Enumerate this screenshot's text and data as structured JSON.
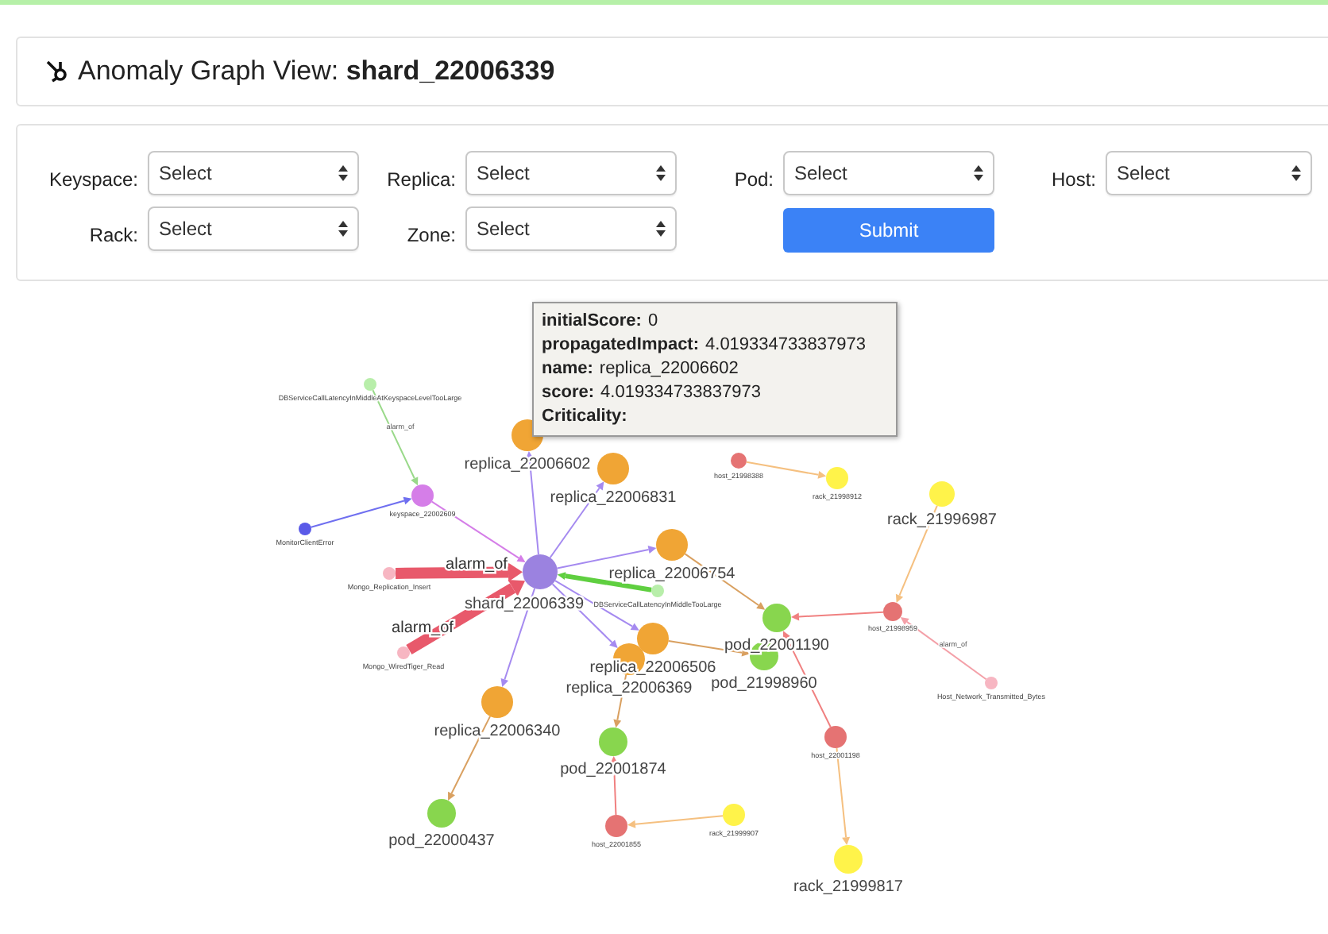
{
  "header": {
    "title": "Anomaly Graph View: **shard_22006339**"
  },
  "filters": [
    {
      "label": "Keyspace:",
      "value": "Select"
    },
    {
      "label": "Replica:",
      "value": "Select"
    },
    {
      "label": "Pod:",
      "value": "Select"
    },
    {
      "label": "Host:",
      "value": "Select"
    },
    {
      "label": "Rack:",
      "value": "Select"
    },
    {
      "label": "Zone:",
      "value": "Select"
    }
  ],
  "submit": "Submit",
  "graph": {
    "nodes": [
      {
        "label": "DBServiceCallLatencyInMiddleAtKeyspaceLevelTooLarge",
        "color": "#b8eeaa",
        "kind": "small"
      },
      {
        "label": "replica_22006602",
        "color": "#f0a535",
        "kind": "large"
      },
      {
        "label": "host_21998388",
        "color": "#e57373",
        "kind": "small"
      },
      {
        "label": "replica_22006831",
        "color": "#f0a535",
        "kind": "large"
      },
      {
        "label": "rack_21998912",
        "color": "#fff34a",
        "kind": "small"
      },
      {
        "label": "keyspace_22002609",
        "color": "#d57ee8",
        "kind": "small"
      },
      {
        "label": "rack_21996987",
        "color": "#fff34a",
        "kind": "large"
      },
      {
        "label": "MonitorClientError",
        "color": "#5a5ae8",
        "kind": "small"
      },
      {
        "label": "replica_22006754",
        "color": "#f0a535",
        "kind": "large"
      },
      {
        "label": "shard_22006339",
        "color": "#9b82e0",
        "kind": "large"
      },
      {
        "label": "Mongo_Replication_Insert",
        "color": "#f7b6c2",
        "kind": "small"
      },
      {
        "label": "DBServiceCallLatencyInMiddleTooLarge",
        "color": "#b8eeaa",
        "kind": "small"
      },
      {
        "label": "host_21998959",
        "color": "#e57373",
        "kind": "small"
      },
      {
        "label": "pod_22001190",
        "color": "#88d64e",
        "kind": "large"
      },
      {
        "label": "Mongo_WiredTiger_Read",
        "color": "#f7b6c2",
        "kind": "small"
      },
      {
        "label": "replica_22006506",
        "color": "#f0a535",
        "kind": "large"
      },
      {
        "label": "replica_22006369",
        "color": "#f0a535",
        "kind": "large"
      },
      {
        "label": "pod_21998960",
        "color": "#88d64e",
        "kind": "large"
      },
      {
        "label": "Host_Network_Transmitted_Bytes",
        "color": "#f7b6c2",
        "kind": "small"
      },
      {
        "label": "replica_22006340",
        "color": "#f0a535",
        "kind": "large"
      },
      {
        "label": "host_22001198",
        "color": "#e57373",
        "kind": "small"
      },
      {
        "label": "pod_22001874",
        "color": "#88d64e",
        "kind": "large"
      },
      {
        "label": "pod_22000437",
        "color": "#88d64e",
        "kind": "large"
      },
      {
        "label": "host_22001855",
        "color": "#e57373",
        "kind": "small"
      },
      {
        "label": "rack_21999907",
        "color": "#fff34a",
        "kind": "small"
      },
      {
        "label": "rack_21999817",
        "color": "#fff34a",
        "kind": "large"
      }
    ],
    "edges": [
      {
        "color": "#9ad98a",
        "kind": "thin",
        "label": "alarm_of"
      },
      {
        "color": "#6f6ff0",
        "kind": "thin"
      },
      {
        "color": "#d57ee8",
        "kind": "thin"
      },
      {
        "color": "#e8596b",
        "kind": "thick",
        "label": "alarm_of"
      },
      {
        "color": "#e8596b",
        "kind": "thick",
        "label": "alarm_of"
      },
      {
        "color": "#5fcf40",
        "kind": "medium"
      },
      {
        "color": "#a58af0",
        "kind": "thin"
      },
      {
        "color": "#a58af0",
        "kind": "thin"
      },
      {
        "color": "#a58af0",
        "kind": "thin"
      },
      {
        "color": "#a58af0",
        "kind": "thin"
      },
      {
        "color": "#a58af0",
        "kind": "thin"
      },
      {
        "color": "#a58af0",
        "kind": "thin"
      },
      {
        "color": "#d9a060",
        "kind": "thin"
      },
      {
        "color": "#d9a060",
        "kind": "thin"
      },
      {
        "color": "#d9a060",
        "kind": "thin"
      },
      {
        "color": "#d9a060",
        "kind": "thin"
      },
      {
        "color": "#f08080",
        "kind": "thin"
      },
      {
        "color": "#f5c080",
        "kind": "thin"
      },
      {
        "color": "#f08080",
        "kind": "thin"
      },
      {
        "color": "#f08080",
        "kind": "thin"
      },
      {
        "color": "#f4a0a8",
        "kind": "thin",
        "label": "alarm_of"
      },
      {
        "color": "#f5c080",
        "kind": "thin"
      },
      {
        "color": "#f5c080",
        "kind": "thin"
      },
      {
        "color": "#f5c080",
        "kind": "thin"
      }
    ]
  },
  "tooltip": [
    {
      "key": "initialScore:",
      "value": "0"
    },
    {
      "key": "propagatedImpact:",
      "value": "4.019334733837973"
    },
    {
      "key": "name:",
      "value": "replica_22006602"
    },
    {
      "key": "score:",
      "value": "4.019334733837973"
    },
    {
      "key": "Criticality:"
    }
  ]
}
